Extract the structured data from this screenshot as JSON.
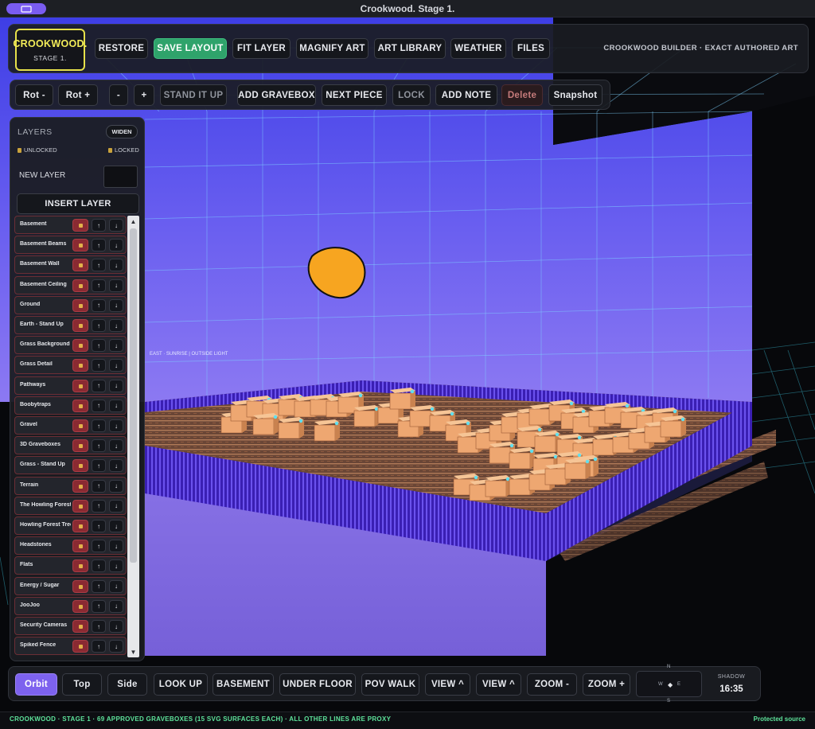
{
  "window": {
    "title": "Crookwood. Stage 1."
  },
  "logo": {
    "name": "CROOKWOOD.",
    "stage": "STAGE 1."
  },
  "toolbar": {
    "buttons": [
      "RESTORE",
      "SAVE LAYOUT",
      "FIT LAYER",
      "MAGNIFY ART",
      "ART LIBRARY",
      "WEATHER",
      "FILES"
    ],
    "right_label": "CROOKWOOD BUILDER · EXACT AUTHORED ART"
  },
  "toolbar2": {
    "buttons": [
      "Rot -",
      "Rot +",
      "-",
      "+",
      "STAND IT UP",
      "ADD GRAVEBOX",
      "NEXT PIECE",
      "LOCK",
      "ADD NOTE",
      "Delete",
      "Snapshot"
    ]
  },
  "layers": {
    "title": "LAYERS",
    "widen": "WIDEN",
    "unlocked": "UNLOCKED",
    "locked": "LOCKED",
    "new_layer": "NEW LAYER",
    "insert": "INSERT LAYER",
    "items": [
      "Basement",
      "Basement Beams",
      "Basement Wall",
      "Basement Ceiling",
      "Ground",
      "Earth - Stand Up",
      "Grass Background",
      "Grass Detail",
      "Pathways",
      "Boobytraps",
      "Gravel",
      "3D Graveboxes",
      "Grass - Stand Up",
      "Terrain",
      "The Howling Forest",
      "Howling Forest Trees",
      "Headstones",
      "Flats",
      "Energy / Sugar",
      "JooJoo",
      "Security Cameras",
      "Spiked Fence"
    ]
  },
  "scene": {
    "wall_label": "EAST · SUNRISE | OUTSIDE LIGHT",
    "sun_color": "#f7a520",
    "sky_color": "#5b55e6"
  },
  "bottom": {
    "buttons": [
      "Orbit",
      "Top",
      "Side",
      "LOOK UP",
      "BASEMENT",
      "UNDER FLOOR",
      "POV WALK",
      "VIEW ^",
      "VIEW ^",
      "ZOOM -",
      "ZOOM +"
    ],
    "compass": {
      "n": "N",
      "s": "S",
      "w": "W",
      "e": "E"
    },
    "shadow_label": "SHADOW",
    "shadow_time": "16:35"
  },
  "status": {
    "left": "CROOKWOOD · STAGE 1 · 69 APPROVED GRAVEBOXES (15 SVG SURFACES EACH) · ALL OTHER LINES ARE PROXY",
    "right": "Protected source"
  },
  "colors": {
    "accent": "#7d62ee",
    "save": "#2fa36b",
    "logo": "#f2ec59",
    "status": "#5ee39b"
  }
}
